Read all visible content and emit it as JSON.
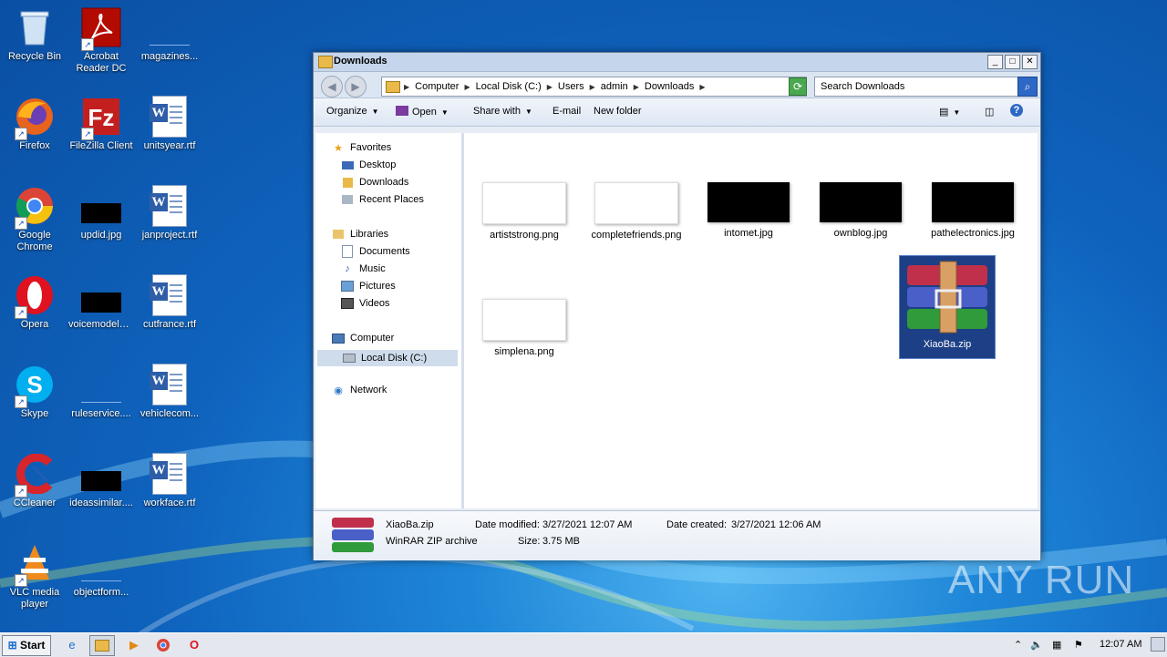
{
  "desktop": {
    "icons": [
      {
        "label": "Recycle Bin"
      },
      {
        "label": "Acrobat Reader DC"
      },
      {
        "label": "magazines..."
      },
      {
        "label": "Firefox"
      },
      {
        "label": "FileZilla Client"
      },
      {
        "label": "unitsyear.rtf"
      },
      {
        "label": "Google Chrome"
      },
      {
        "label": "updid.jpg"
      },
      {
        "label": "janproject.rtf"
      },
      {
        "label": "Opera"
      },
      {
        "label": "voicemodels...."
      },
      {
        "label": "cutfrance.rtf"
      },
      {
        "label": "Skype"
      },
      {
        "label": "ruleservice...."
      },
      {
        "label": "vehiclecom..."
      },
      {
        "label": "CCleaner"
      },
      {
        "label": "ideassimilar...."
      },
      {
        "label": "workface.rtf"
      },
      {
        "label": "VLC media player"
      },
      {
        "label": "objectform..."
      }
    ]
  },
  "window": {
    "title": "Downloads",
    "address": [
      "Computer",
      "Local Disk (C:)",
      "Users",
      "admin",
      "Downloads"
    ],
    "search_placeholder": "Search Downloads",
    "toolbar": {
      "organize": "Organize",
      "open": "Open",
      "share_with": "Share with",
      "email": "E-mail",
      "new_folder": "New folder"
    },
    "nav": {
      "favorites": "Favorites",
      "desktop": "Desktop",
      "downloads": "Downloads",
      "recent_places": "Recent Places",
      "libraries": "Libraries",
      "documents": "Documents",
      "music": "Music",
      "pictures": "Pictures",
      "videos": "Videos",
      "computer": "Computer",
      "local_disk": "Local Disk (C:)",
      "network": "Network"
    },
    "files": [
      {
        "name": "artiststrong.png",
        "thumb": "white"
      },
      {
        "name": "completefriends.png",
        "thumb": "white"
      },
      {
        "name": "intomet.jpg",
        "thumb": "black"
      },
      {
        "name": "ownblog.jpg",
        "thumb": "black"
      },
      {
        "name": "pathelectronics.jpg",
        "thumb": "black"
      },
      {
        "name": "simplena.png",
        "thumb": "white"
      },
      {
        "name": "XiaoBa.zip",
        "thumb": "rar",
        "selected": true
      }
    ],
    "details": {
      "name": "XiaoBa.zip",
      "type": "WinRAR ZIP archive",
      "modified_label": "Date modified:",
      "modified_value": "3/27/2021 12:07 AM",
      "created_label": "Date created:",
      "created_value": "3/27/2021 12:06 AM",
      "size_label": "Size:",
      "size_value": "3.75 MB"
    }
  },
  "taskbar": {
    "start": "Start",
    "clock": "12:07 AM"
  },
  "watermark": "ANY RUN"
}
